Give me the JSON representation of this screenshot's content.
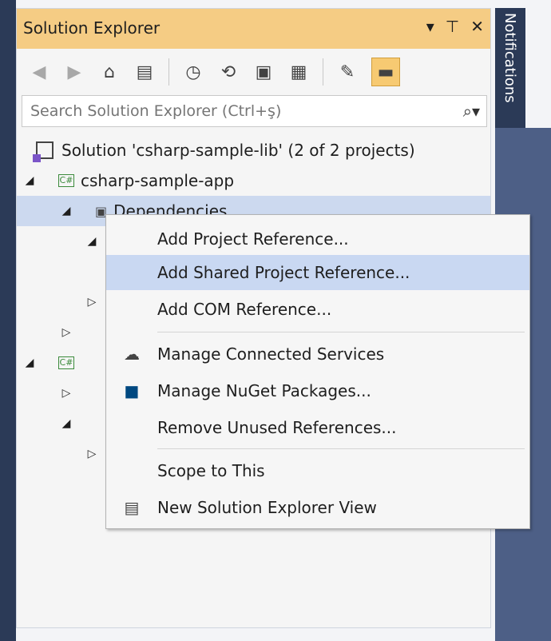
{
  "panel": {
    "title": "Solution Explorer",
    "title_actions": [
      "▾",
      "⊤",
      "✕"
    ]
  },
  "toolbar": {
    "icons": [
      "back-icon",
      "forward-icon",
      "home-icon",
      "switch-views-icon",
      "pending-changes-filter-icon",
      "sync-with-active-document-icon",
      "collapse-all-icon",
      "show-all-files-icon",
      "properties-icon",
      "preview-selected-items-icon"
    ]
  },
  "search": {
    "placeholder": "Search Solution Explorer (Ctrl+ş)"
  },
  "tree": {
    "solution": "Solution 'csharp-sample-lib' (2 of 2 projects)",
    "project_app": "csharp-sample-app",
    "dependencies": "Dependencies",
    "project_badge": "C#"
  },
  "context_menu": {
    "items": [
      {
        "label": "Add Project Reference...",
        "icon": ""
      },
      {
        "label": "Add Shared Project Reference...",
        "icon": ""
      },
      {
        "label": "Add COM Reference...",
        "icon": ""
      },
      {
        "label": "Manage Connected Services",
        "icon": "connected-services-icon"
      },
      {
        "label": "Manage NuGet Packages...",
        "icon": "nuget-icon"
      },
      {
        "label": "Remove Unused References...",
        "icon": ""
      },
      {
        "label": "Scope to This",
        "icon": ""
      },
      {
        "label": "New Solution Explorer View",
        "icon": "new-solution-explorer-view-icon"
      }
    ]
  },
  "notifications": {
    "label": "Notifications"
  },
  "colors": {
    "title_bar": "#f5cc84",
    "highlight": "#c9d8f2",
    "side_panel": "#2b3a57"
  }
}
